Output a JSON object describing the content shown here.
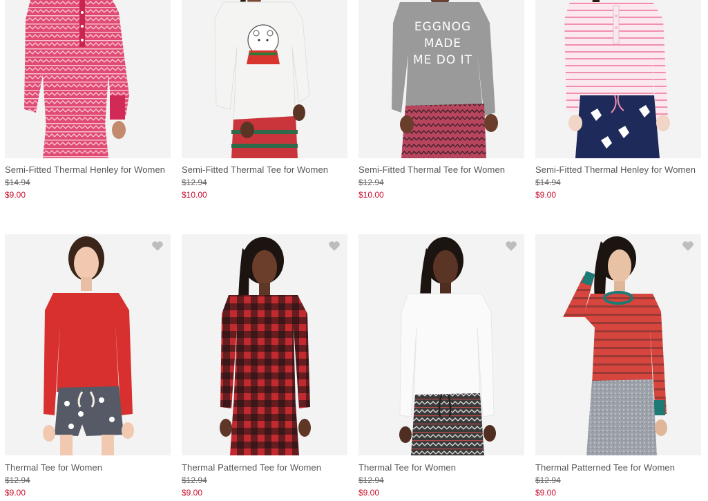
{
  "products": [
    {
      "title": "Semi-Fitted Thermal Henley for Women",
      "original_price": "$14.94",
      "sale_price": "$9.00",
      "image": "model-pink-fairisle-henley",
      "favorite_icon": "heart-icon",
      "top_color": "#e04a73",
      "bottom_color": "#d9567a"
    },
    {
      "title": "Semi-Fitted Thermal Tee for Women",
      "original_price": "$12.94",
      "sale_price": "$10.00",
      "image": "model-white-polar-bear-tee",
      "favorite_icon": "heart-icon",
      "top_color": "#f4f4f2",
      "bottom_color": "#c9353a"
    },
    {
      "title": "Semi-Fitted Thermal Tee for Women",
      "original_price": "$12.94",
      "sale_price": "$10.00",
      "image": "model-grey-eggnog-tee",
      "graphic_text": "EGGNOG MADE ME DO IT",
      "favorite_icon": "heart-icon",
      "top_color": "#9a9a9a",
      "bottom_color": "#b8455e"
    },
    {
      "title": "Semi-Fitted Thermal Henley for Women",
      "original_price": "$14.94",
      "sale_price": "$9.00",
      "image": "model-pink-stripe-henley",
      "favorite_icon": "heart-icon",
      "top_color": "#f7d9e3",
      "bottom_color": "#1e2a5a"
    },
    {
      "title": "Thermal Tee for Women",
      "original_price": "$12.94",
      "sale_price": "$9.00",
      "image": "model-red-thermal-tee",
      "favorite_icon": "heart-icon",
      "top_color": "#d8302f",
      "bottom_color": "#555a66"
    },
    {
      "title": "Thermal Patterned Tee for Women",
      "original_price": "$12.94",
      "sale_price": "$9.00",
      "image": "model-buffalo-check-tee",
      "favorite_icon": "heart-icon",
      "top_color": "#c22a2f",
      "bottom_color": "#c22a2f"
    },
    {
      "title": "Thermal Tee for Women",
      "original_price": "$12.94",
      "sale_price": "$9.00",
      "image": "model-white-thermal-tee",
      "favorite_icon": "heart-icon",
      "top_color": "#fafafa",
      "bottom_color": "#3a3a3a"
    },
    {
      "title": "Thermal Patterned Tee for Women",
      "original_price": "$12.94",
      "sale_price": "$9.00",
      "image": "model-red-stripe-tee",
      "favorite_icon": "heart-icon",
      "top_color": "#d6453e",
      "bottom_color": "#9ea3ab"
    }
  ],
  "colors": {
    "sale_price": "#c8102e",
    "title_text": "#555555",
    "photo_background": "#f3f3f3",
    "heart_icon": "#bdbdbd"
  }
}
